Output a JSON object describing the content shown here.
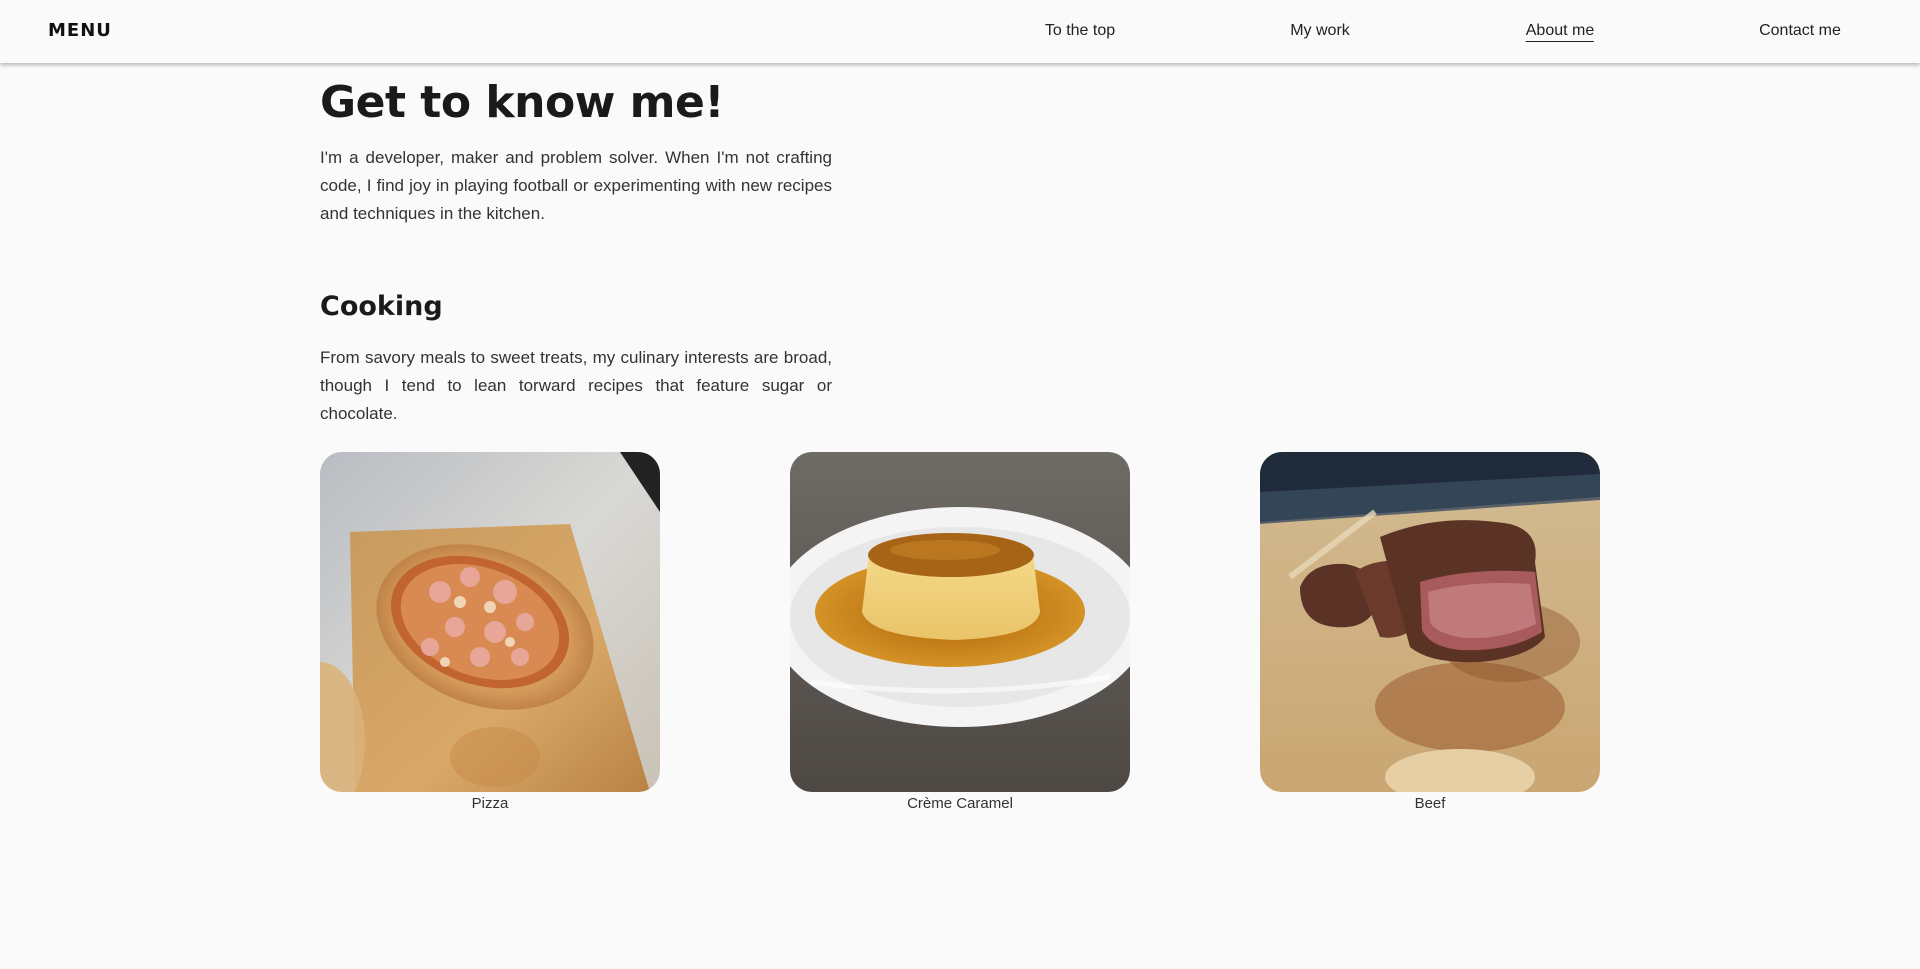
{
  "nav": {
    "menu_label": "MENU",
    "links": [
      {
        "label": "To the top",
        "active": false
      },
      {
        "label": "My work",
        "active": false
      },
      {
        "label": "About me",
        "active": true
      },
      {
        "label": "Contact me",
        "active": false
      }
    ]
  },
  "about": {
    "title": "Get to know me!",
    "intro": "I'm a developer, maker and problem solver. When I'm not crafting code, I find joy in playing football or experimenting with new recipes and techniques in the kitchen."
  },
  "cooking": {
    "title": "Cooking",
    "text": "From savory meals to sweet treats, my culinary interests are broad, though I tend to lean torward recipes that feature sugar or chocolate.",
    "dishes": [
      {
        "caption": "Pizza",
        "photo": "pizza-photo"
      },
      {
        "caption": "Crème Caramel",
        "photo": "creme-caramel-photo"
      },
      {
        "caption": "Beef",
        "photo": "beef-photo"
      }
    ]
  }
}
